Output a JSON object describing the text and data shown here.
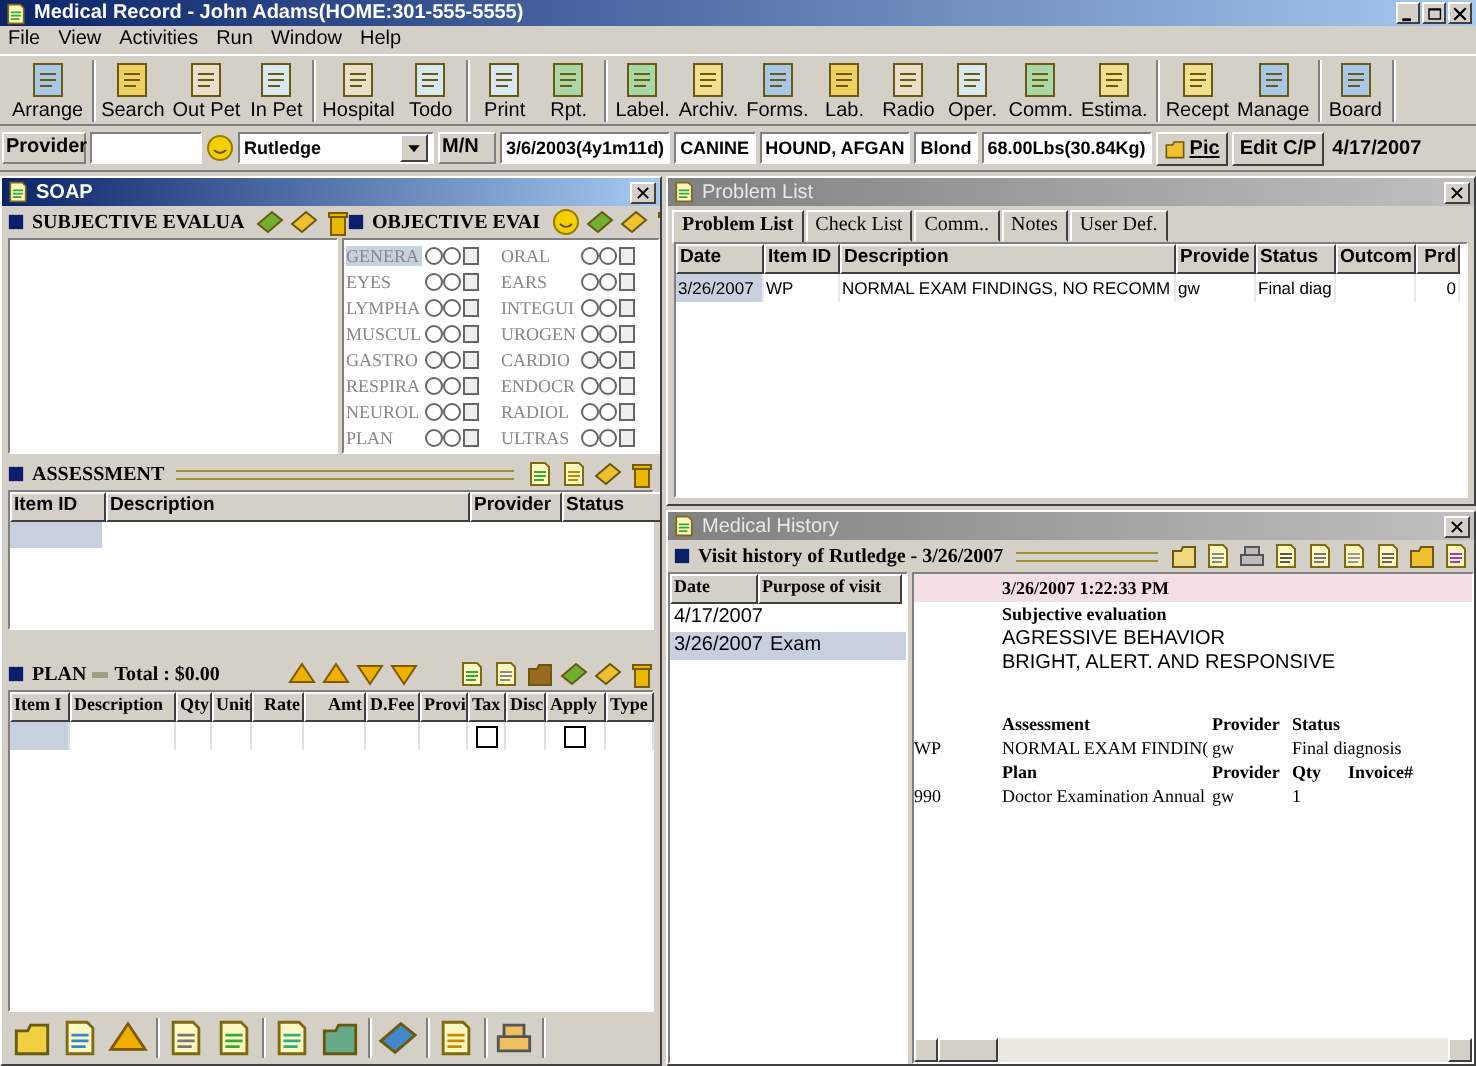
{
  "window": {
    "title": "Medical Record - John Adams(HOME:301-555-5555)"
  },
  "menu": [
    "File",
    "View",
    "Activities",
    "Run",
    "Window",
    "Help"
  ],
  "toolbar": [
    [
      "Arrange"
    ],
    [
      "Search",
      "Out Pet",
      "In Pet"
    ],
    [
      "Hospital",
      "Todo"
    ],
    [
      "Print",
      "Rpt."
    ],
    [
      "Label.",
      "Archiv.",
      "Forms.",
      "Lab.",
      "Radio",
      "Oper.",
      "Comm.",
      "Estima."
    ],
    [
      "Recept",
      "Manage"
    ],
    [
      "Board"
    ]
  ],
  "patient_bar": {
    "provider_label": "Provider",
    "patient": "Rutledge",
    "mn": "M/N",
    "birth": "3/6/2003(4y1m11d)",
    "species": "CANINE",
    "breed": "HOUND, AFGAN",
    "coat": "Blond",
    "weight": "68.00Lbs(30.84Kg)",
    "pic": "Pic",
    "edit": "Edit C/P",
    "date": "4/17/2007"
  },
  "soap": {
    "title": "SOAP",
    "active": true,
    "subjective": {
      "title": "SUBJECTIVE EVALUA"
    },
    "objective": {
      "title": "OBJECTIVE EVAI",
      "items": [
        {
          "label": "GENERA",
          "selected": true
        },
        {
          "label": "ORAL",
          "selected": false
        },
        {
          "label": "EYES",
          "selected": false
        },
        {
          "label": "EARS",
          "selected": false
        },
        {
          "label": "LYMPHA",
          "selected": false
        },
        {
          "label": "INTEGUI",
          "selected": false
        },
        {
          "label": "MUSCUL",
          "selected": false
        },
        {
          "label": "UROGEN",
          "selected": false
        },
        {
          "label": "GASTRO",
          "selected": false
        },
        {
          "label": "CARDIO",
          "selected": false
        },
        {
          "label": "RESPIRA",
          "selected": false
        },
        {
          "label": "ENDOCR",
          "selected": false
        },
        {
          "label": "NEUROL",
          "selected": false
        },
        {
          "label": "RADIOL",
          "selected": false
        },
        {
          "label": "PLAN",
          "selected": false
        },
        {
          "label": "ULTRAS",
          "selected": false
        }
      ]
    },
    "assessment": {
      "title": "ASSESSMENT",
      "columns": [
        "Item ID",
        "Description",
        "Provider",
        "Status"
      ]
    },
    "plan": {
      "title": "PLAN",
      "total": "Total : $0.00",
      "columns": [
        "Item I",
        "Description",
        "Qty",
        "Unit",
        "Rate",
        "Amt",
        "D.Fee",
        "Provi",
        "Tax",
        "Disc",
        "Apply",
        "Type"
      ],
      "rows": [
        {
          "tax": false,
          "apply": false
        }
      ]
    }
  },
  "problem_list": {
    "title": "Problem List",
    "active": false,
    "tabs": [
      {
        "label": "Problem List",
        "selected": true
      },
      {
        "label": "Check List",
        "selected": false
      },
      {
        "label": "Comm..",
        "selected": false
      },
      {
        "label": "Notes",
        "selected": false
      },
      {
        "label": "User Def.",
        "selected": false
      }
    ],
    "columns": [
      "Date",
      "Item ID",
      "Description",
      "Provide",
      "Status",
      "Outcom",
      "Prd"
    ],
    "rows": [
      {
        "selected": true,
        "cells": [
          "3/26/2007",
          "WP",
          "NORMAL EXAM FINDINGS, NO RECOMM",
          "gw",
          "Final diag",
          "",
          "0"
        ]
      }
    ]
  },
  "medical_history": {
    "title": "Medical History",
    "active": false,
    "header": "Visit history of Rutledge - 3/26/2007",
    "visit_columns": [
      "Date",
      "Purpose of visit"
    ],
    "visits": [
      {
        "date": "4/17/2007",
        "selected": false
      },
      {
        "date": "3/26/2007",
        "purpose": "Exam",
        "selected": true
      }
    ],
    "detail": {
      "timestamp": "3/26/2007 1:22:33 PM",
      "subjective_heading": "Subjective evaluation",
      "subjective_lines": [
        "AGRESSIVE BEHAVIOR",
        "BRIGHT, ALERT. AND RESPONSIVE"
      ],
      "assessment_columns": [
        "Assessment",
        "Provider",
        "Status"
      ],
      "assessment_rows": [
        [
          "WP",
          "NORMAL EXAM FINDIN(",
          "gw",
          "Final diagnosis"
        ]
      ],
      "plan_columns": [
        "Plan",
        "Provider",
        "Qty",
        "Invoice#"
      ],
      "plan_rows": [
        [
          "990",
          "Doctor Examination Annual",
          "gw",
          "1"
        ]
      ]
    }
  }
}
